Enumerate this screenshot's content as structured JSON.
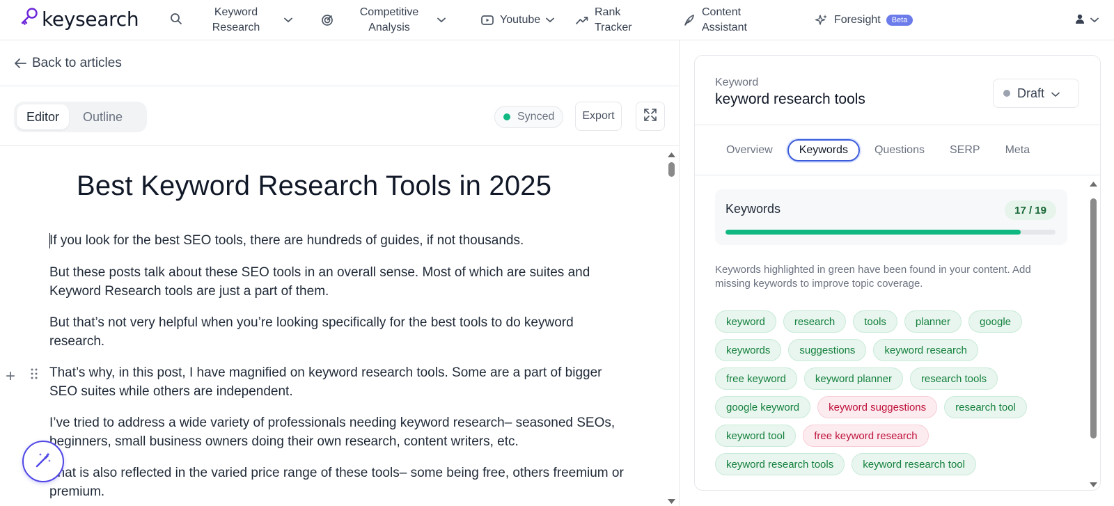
{
  "brand": {
    "name": "keysearch",
    "icon": "key-icon",
    "accent": "#6d28d9"
  },
  "nav": {
    "search_icon": "search-icon",
    "items": [
      {
        "label": "Keyword Research",
        "icon": "",
        "has_chevron": true
      },
      {
        "label": "Competitive Analysis",
        "icon": "target-icon",
        "has_chevron": true
      },
      {
        "label": "Youtube",
        "icon": "youtube-icon",
        "has_chevron": true
      },
      {
        "label": "Rank Tracker",
        "icon": "trend-icon",
        "has_chevron": false
      },
      {
        "label": "Content Assistant",
        "icon": "feather-icon",
        "has_chevron": false
      },
      {
        "label": "Foresight",
        "icon": "sparkle-icon",
        "badge": "Beta"
      }
    ],
    "user_icon": "user-icon"
  },
  "left": {
    "back_label": "Back to articles",
    "tabs": [
      {
        "label": "Editor",
        "active": true
      },
      {
        "label": "Outline",
        "active": false
      }
    ],
    "sync_status": "Synced",
    "sync_color": "#10b981",
    "export_label": "Export",
    "expand_icon": "expand-icon"
  },
  "article": {
    "title": "Best Keyword Research Tools in 2025",
    "paragraphs": [
      "If you look for the best SEO tools, there are hundreds of guides, if not thousands.",
      "But these posts talk about these SEO tools in an overall sense. Most of which are suites and Keyword Research tools are just a part of them.",
      "But that’s not very helpful when you’re looking specifically for the best tools to do keyword research.",
      "That’s why, in this post, I have magnified on keyword research tools. Some are a part of bigger SEO suites while others are independent.",
      "I’ve tried to address a wide variety of professionals needing keyword research– seasoned SEOs, beginners, small business owners doing their own research, content writers, etc.",
      "That is also reflected in the varied price range of these tools– some being free, others freemium or premium."
    ]
  },
  "right": {
    "keyword_label": "Keyword",
    "keyword_value": "keyword research tools",
    "status": "Draft",
    "tabs": [
      {
        "label": "Overview",
        "active": false
      },
      {
        "label": "Keywords",
        "active": true
      },
      {
        "label": "Questions",
        "active": false
      },
      {
        "label": "SERP",
        "active": false
      },
      {
        "label": "Meta",
        "active": false
      }
    ],
    "keywords_card": {
      "title": "Keywords",
      "count": "17 / 19",
      "found": 17,
      "total": 19,
      "progress_color": "#10b981"
    },
    "hint": "Keywords highlighted in green have been found in your content. Add missing keywords to improve topic coverage.",
    "chip_rows": [
      [
        {
          "label": "keyword",
          "found": true
        },
        {
          "label": "research",
          "found": true
        },
        {
          "label": "tools",
          "found": true
        },
        {
          "label": "planner",
          "found": true
        },
        {
          "label": "google",
          "found": true
        }
      ],
      [
        {
          "label": "keywords",
          "found": true
        },
        {
          "label": "suggestions",
          "found": true
        },
        {
          "label": "keyword research",
          "found": true
        }
      ],
      [
        {
          "label": "free keyword",
          "found": true
        },
        {
          "label": "keyword planner",
          "found": true
        },
        {
          "label": "research tools",
          "found": true
        }
      ],
      [
        {
          "label": "google keyword",
          "found": true
        },
        {
          "label": "keyword suggestions",
          "found": false
        },
        {
          "label": "research tool",
          "found": true
        }
      ],
      [
        {
          "label": "keyword tool",
          "found": true
        },
        {
          "label": "free keyword research",
          "found": false
        }
      ],
      [
        {
          "label": "keyword research tools",
          "found": true
        },
        {
          "label": "keyword research tool",
          "found": true
        }
      ]
    ]
  }
}
